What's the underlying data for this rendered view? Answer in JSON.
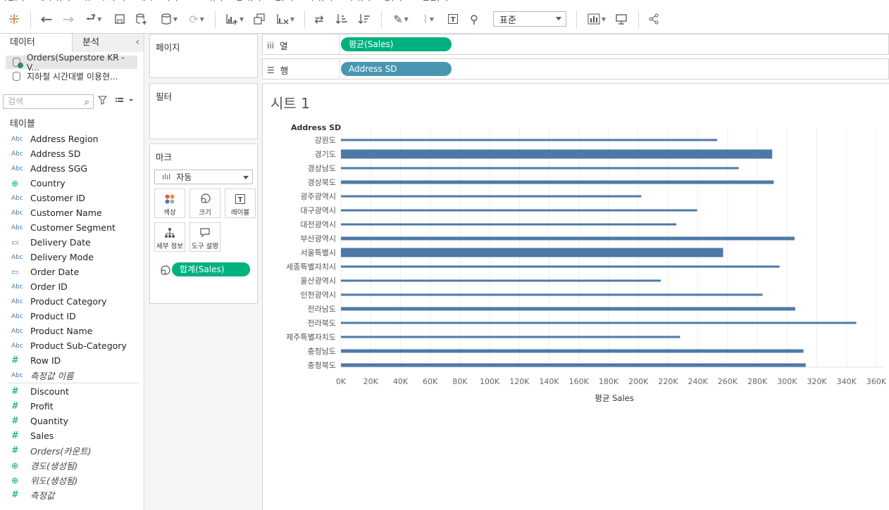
{
  "menubar": [
    "파일(F)",
    "데이터(D)",
    "워크시트(W)",
    "대시보드(B)",
    "스토리(T)",
    "분석(A)",
    "맵(M)",
    "서식(O)",
    "서버(S)",
    "창(N)",
    "도움말(H)"
  ],
  "toolbar": {
    "icons": [
      "tableau-logo-icon",
      "undo-icon",
      "redo-icon",
      "replay-icon",
      "save-icon",
      "new-datasource-icon",
      "datasource-icon",
      "refresh-icon",
      "new-worksheet-icon",
      "duplicate-icon",
      "clear-icon",
      "swap-icon",
      "sort-asc-icon",
      "sort-desc-icon",
      "highlight-icon",
      "group-icon",
      "label-icon",
      "pin-icon",
      "show-me-icon",
      "presentation-icon",
      "share-icon"
    ],
    "fit_selector": "표준"
  },
  "datapane": {
    "tab_data": "데이터",
    "tab_analysis": "분석",
    "sources": [
      {
        "label": "Orders(Superstore KR - V...",
        "selected": true
      },
      {
        "label": "지하철 시간대별 이용현...",
        "selected": false
      }
    ],
    "search_placeholder": "검색",
    "tables_label": "테이블",
    "dimensions": [
      {
        "icon": "Abc",
        "label": "Address Region",
        "type": "string"
      },
      {
        "icon": "Abc",
        "label": "Address SD",
        "type": "string"
      },
      {
        "icon": "Abc",
        "label": "Address SGG",
        "type": "string"
      },
      {
        "icon": "⊕",
        "label": "Country",
        "type": "geo"
      },
      {
        "icon": "Abc",
        "label": "Customer ID",
        "type": "string"
      },
      {
        "icon": "Abc",
        "label": "Customer Name",
        "type": "string"
      },
      {
        "icon": "Abc",
        "label": "Customer Segment",
        "type": "string"
      },
      {
        "icon": "▭",
        "label": "Delivery Date",
        "type": "date"
      },
      {
        "icon": "Abc",
        "label": "Delivery Mode",
        "type": "string"
      },
      {
        "icon": "▭",
        "label": "Order Date",
        "type": "date"
      },
      {
        "icon": "Abc",
        "label": "Order ID",
        "type": "string"
      },
      {
        "icon": "Abc",
        "label": "Product Category",
        "type": "string"
      },
      {
        "icon": "Abc",
        "label": "Product ID",
        "type": "string"
      },
      {
        "icon": "Abc",
        "label": "Product Name",
        "type": "string"
      },
      {
        "icon": "Abc",
        "label": "Product Sub-Category",
        "type": "string"
      },
      {
        "icon": "#",
        "label": "Row ID",
        "type": "number"
      },
      {
        "icon": "Abc",
        "label": "측정값 이름",
        "type": "string-italic"
      }
    ],
    "measures": [
      {
        "icon": "#",
        "label": "Discount",
        "italic": false,
        "geo": false
      },
      {
        "icon": "#",
        "label": "Profit",
        "italic": false,
        "geo": false
      },
      {
        "icon": "#",
        "label": "Quantity",
        "italic": false,
        "geo": false
      },
      {
        "icon": "#",
        "label": "Sales",
        "italic": false,
        "geo": false
      },
      {
        "icon": "#",
        "label": "Orders(카운트)",
        "italic": true,
        "geo": false
      },
      {
        "icon": "⊕",
        "label": "경도(생성됨)",
        "italic": true,
        "geo": true
      },
      {
        "icon": "⊕",
        "label": "위도(생성됨)",
        "italic": true,
        "geo": true
      },
      {
        "icon": "#",
        "label": "측정값",
        "italic": true,
        "geo": false
      }
    ]
  },
  "cards": {
    "pages": "페이지",
    "filters": "필터",
    "marks": "마크",
    "mark_type": "자동",
    "mark_buttons": [
      {
        "label": "색상",
        "icon": "color-icon"
      },
      {
        "label": "크기",
        "icon": "size-icon"
      },
      {
        "label": "레이블",
        "icon": "label-icon"
      },
      {
        "label": "세부 정보",
        "icon": "detail-icon"
      },
      {
        "label": "도구 설명",
        "icon": "tooltip-icon"
      }
    ],
    "size_pill": "합계(Sales)"
  },
  "shelves": {
    "columns_label": "열",
    "columns_pill": "평균(Sales)",
    "rows_label": "행",
    "rows_pill": "Address SD"
  },
  "colors": {
    "bar": "#4e79a7",
    "measure_pill": "#00b180",
    "dimension_pill": "#4996b2"
  },
  "view": {
    "sheet_title": "시트 1"
  },
  "chart_data": {
    "type": "bar",
    "orientation": "horizontal",
    "row_header": "Address SD",
    "xlabel": "평균 Sales",
    "xlim": [
      0,
      360000
    ],
    "x_ticks": [
      "0K",
      "20K",
      "40K",
      "60K",
      "80K",
      "100K",
      "120K",
      "140K",
      "160K",
      "180K",
      "200K",
      "220K",
      "240K",
      "260K",
      "280K",
      "300K",
      "320K",
      "340K",
      "360K"
    ],
    "categories": [
      "강원도",
      "경기도",
      "경상남도",
      "경상북도",
      "광주광역시",
      "대구광역시",
      "대전광역시",
      "부산광역시",
      "서울특별시",
      "세종특별자치시",
      "울산광역시",
      "인천광역시",
      "전라남도",
      "전라북도",
      "제주특별자치도",
      "충청남도",
      "충청북도"
    ],
    "values": [
      253000,
      290000,
      267500,
      291000,
      202000,
      239500,
      225500,
      305000,
      257000,
      295000,
      215000,
      283500,
      305500,
      346500,
      228000,
      311000,
      312500
    ],
    "bar_weights": [
      0.08,
      1,
      0.08,
      0.3,
      0.08,
      0.08,
      0.08,
      0.3,
      1,
      0.08,
      0.08,
      0.08,
      0.3,
      0.08,
      0.08,
      0.3,
      0.3
    ],
    "grid": true,
    "gridlines": "vertical"
  }
}
